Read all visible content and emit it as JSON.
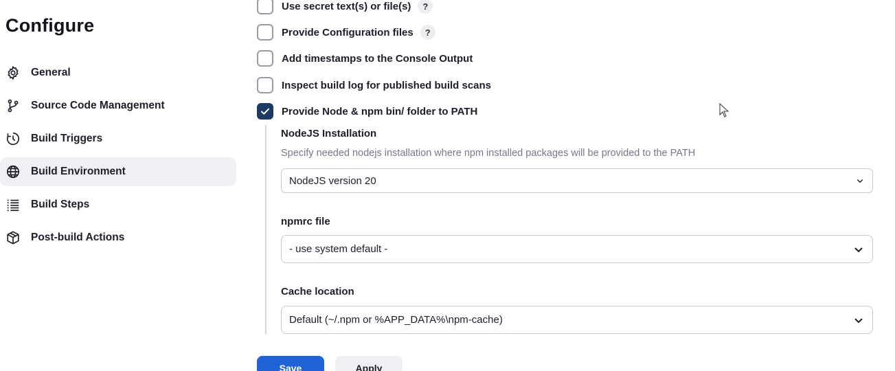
{
  "page": {
    "title": "Configure"
  },
  "sidebar": {
    "items": [
      {
        "label": "General",
        "icon": "gear-icon",
        "active": false
      },
      {
        "label": "Source Code Management",
        "icon": "branch-icon",
        "active": false
      },
      {
        "label": "Build Triggers",
        "icon": "clock-icon",
        "active": false
      },
      {
        "label": "Build Environment",
        "icon": "globe-icon",
        "active": true
      },
      {
        "label": "Build Steps",
        "icon": "list-icon",
        "active": false
      },
      {
        "label": "Post-build Actions",
        "icon": "package-icon",
        "active": false
      }
    ]
  },
  "options": [
    {
      "label": "Use secret text(s) or file(s)",
      "checked": false,
      "help": "?"
    },
    {
      "label": "Provide Configuration files",
      "checked": false,
      "help": "?"
    },
    {
      "label": "Add timestamps to the Console Output",
      "checked": false
    },
    {
      "label": "Inspect build log for published build scans",
      "checked": false
    },
    {
      "label": "Provide Node & npm bin/ folder to PATH",
      "checked": true
    }
  ],
  "node": {
    "installation_label": "NodeJS Installation",
    "installation_desc": "Specify needed nodejs installation where npm installed packages will be provided to the PATH",
    "installation_value": "NodeJS version 20",
    "npmrc_label": "npmrc file",
    "npmrc_value": "- use system default -",
    "cache_label": "Cache location",
    "cache_value": "Default (~/.npm or %APP_DATA%\\npm-cache)"
  },
  "actions": {
    "save": "Save",
    "apply": "Apply"
  },
  "colors": {
    "accent": "#1f63d6",
    "checked": "#1b3a64",
    "active_bg": "#f0f0f4"
  }
}
